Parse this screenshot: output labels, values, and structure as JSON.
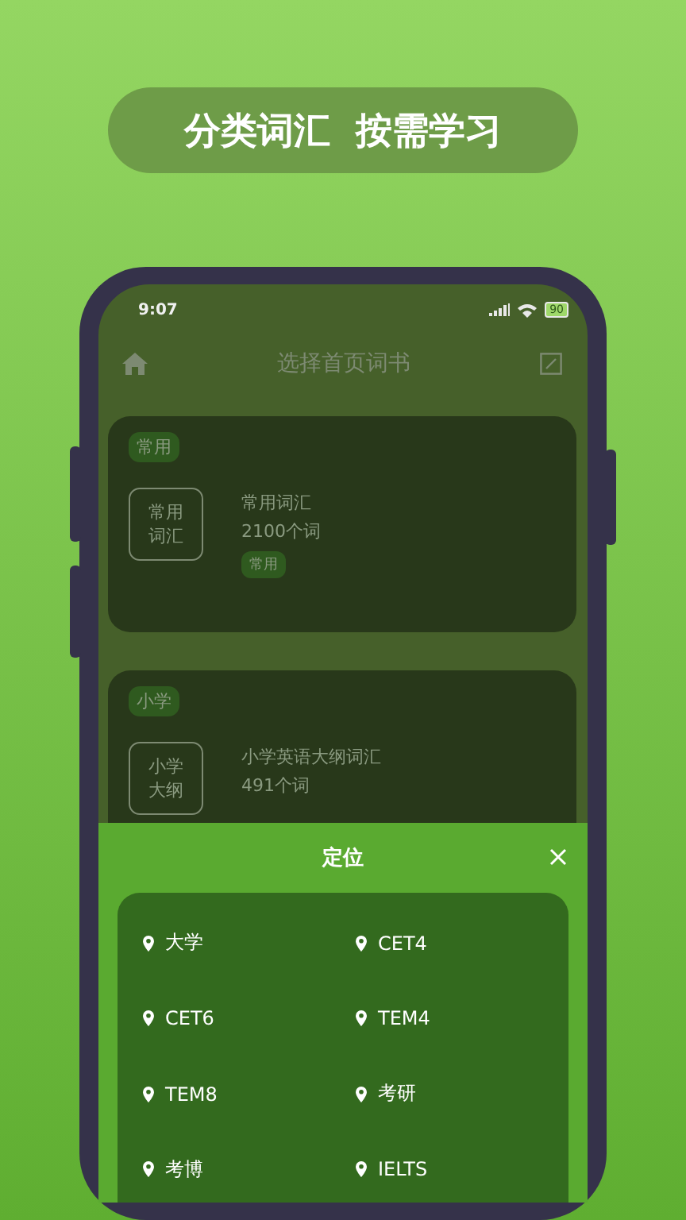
{
  "banner": {
    "text": "分类词汇  按需学习"
  },
  "status_bar": {
    "time": "9:07",
    "battery": "90"
  },
  "header": {
    "title": "选择首页词书"
  },
  "books": [
    {
      "category": "常用",
      "cover": [
        "常用",
        "词汇"
      ],
      "name": "常用词汇",
      "count": "2100个词",
      "tags": [
        "常用"
      ]
    },
    {
      "category": "小学",
      "cover": [
        "小学",
        "大纲"
      ],
      "name": "小学英语大纲词汇",
      "count": "491个词"
    }
  ],
  "sheet": {
    "title": "定位",
    "items": [
      "大学",
      "CET4",
      "CET6",
      "TEM4",
      "TEM8",
      "考研",
      "考博",
      "IELTS"
    ]
  }
}
